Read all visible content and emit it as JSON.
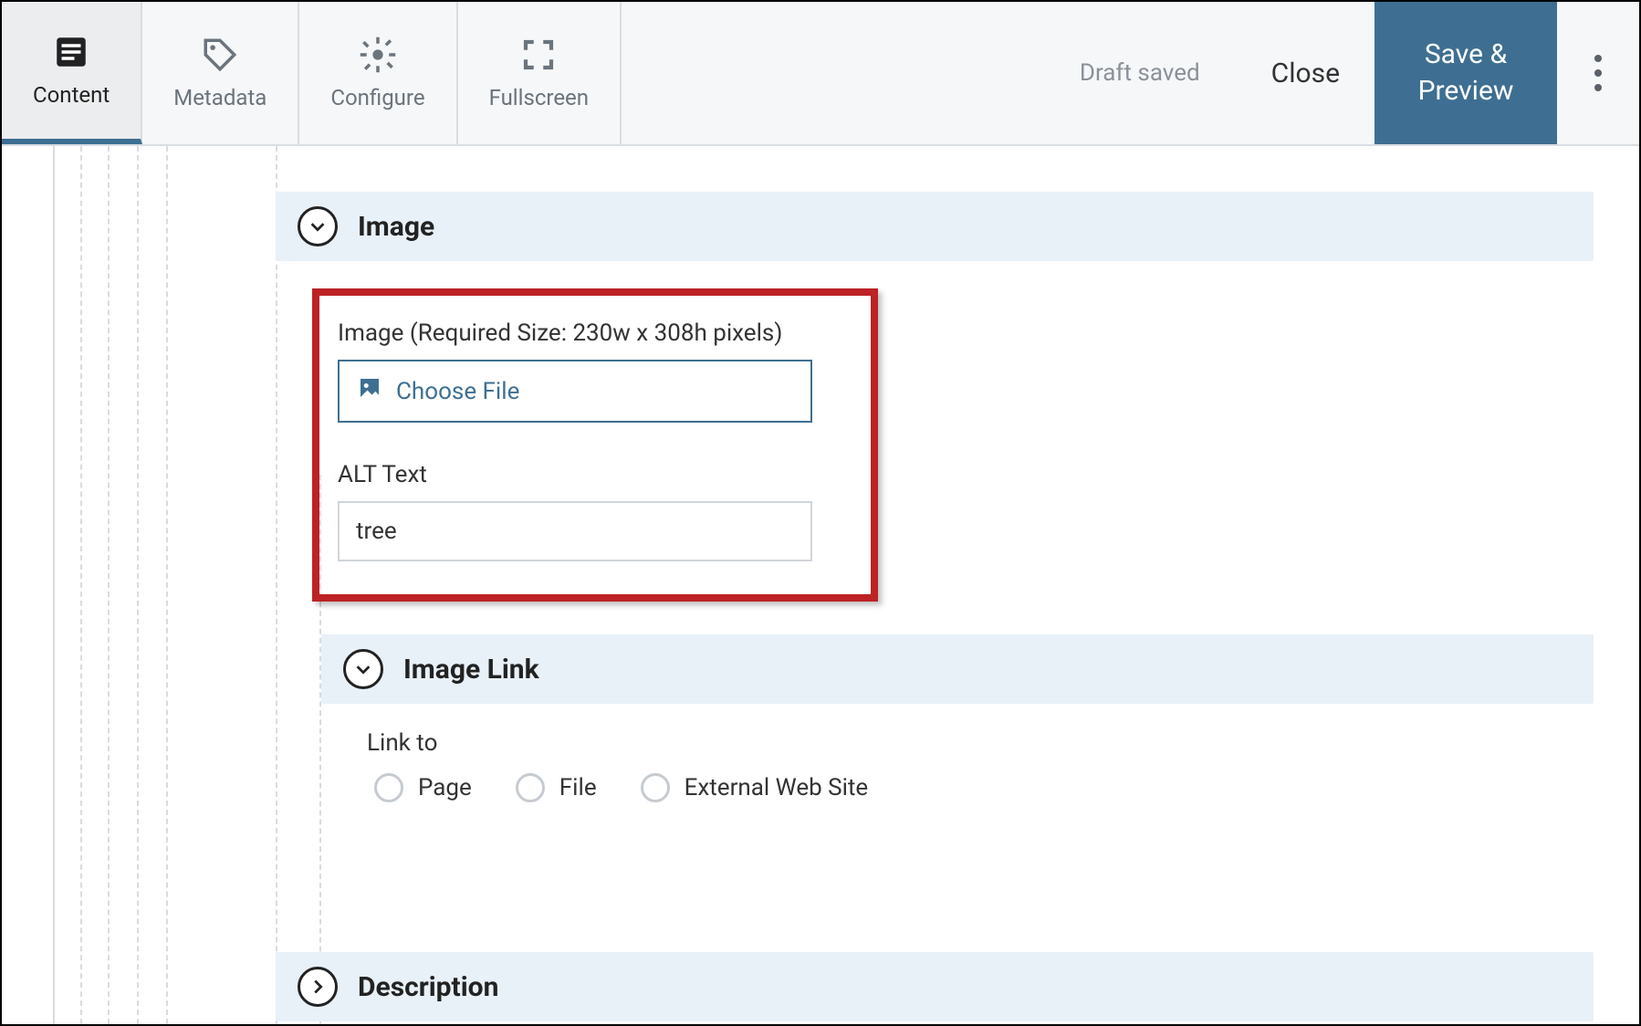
{
  "toolbar": {
    "tabs": {
      "content": "Content",
      "metadata": "Metadata",
      "configure": "Configure",
      "fullscreen": "Fullscreen"
    },
    "status": "Draft saved",
    "close": "Close",
    "save": "Save & Preview"
  },
  "sections": {
    "image": {
      "title": "Image",
      "field_label": "Image (Required Size: 230w x 308h pixels)",
      "choose_file": "Choose File",
      "alt_label": "ALT Text",
      "alt_value": "tree"
    },
    "image_link": {
      "title": "Image Link",
      "link_to_label": "Link to",
      "options": {
        "page": "Page",
        "file": "File",
        "external": "External Web Site"
      }
    },
    "description": {
      "title": "Description"
    }
  },
  "colors": {
    "accent": "#3e6f92",
    "highlight": "#bd2225",
    "panel": "#e8f0f8"
  }
}
